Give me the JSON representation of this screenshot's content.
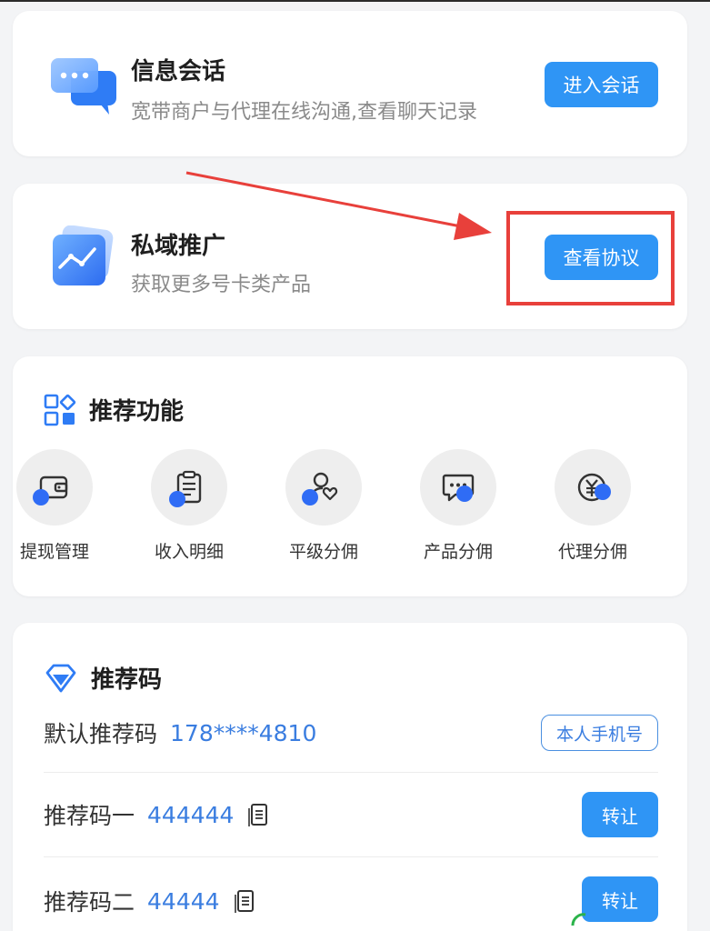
{
  "chat": {
    "title": "信息会话",
    "subtitle": "宽带商户与代理在线沟通,查看聊天记录",
    "button": "进入会话"
  },
  "promo": {
    "title": "私域推广",
    "subtitle": "获取更多号卡类产品",
    "button": "查看协议"
  },
  "features": {
    "title": "推荐功能",
    "items": [
      {
        "label": "提现管理",
        "icon": "wallet-icon"
      },
      {
        "label": "收入明细",
        "icon": "clipboard-icon"
      },
      {
        "label": "平级分佣",
        "icon": "user-heart-icon"
      },
      {
        "label": "产品分佣",
        "icon": "chat-bubble-icon"
      },
      {
        "label": "代理分佣",
        "icon": "yuan-coin-icon"
      }
    ]
  },
  "codes": {
    "title": "推荐码",
    "default_label": "默认推荐码",
    "default_value": "178****4810",
    "default_tag": "本人手机号",
    "rows": [
      {
        "label": "推荐码一",
        "value": "444444",
        "button": "转让"
      },
      {
        "label": "推荐码二",
        "value": "44444",
        "button": "转让"
      }
    ]
  },
  "colors": {
    "accent": "#2f95f5",
    "annotation": "#e8403b",
    "link": "#3a7de0"
  }
}
